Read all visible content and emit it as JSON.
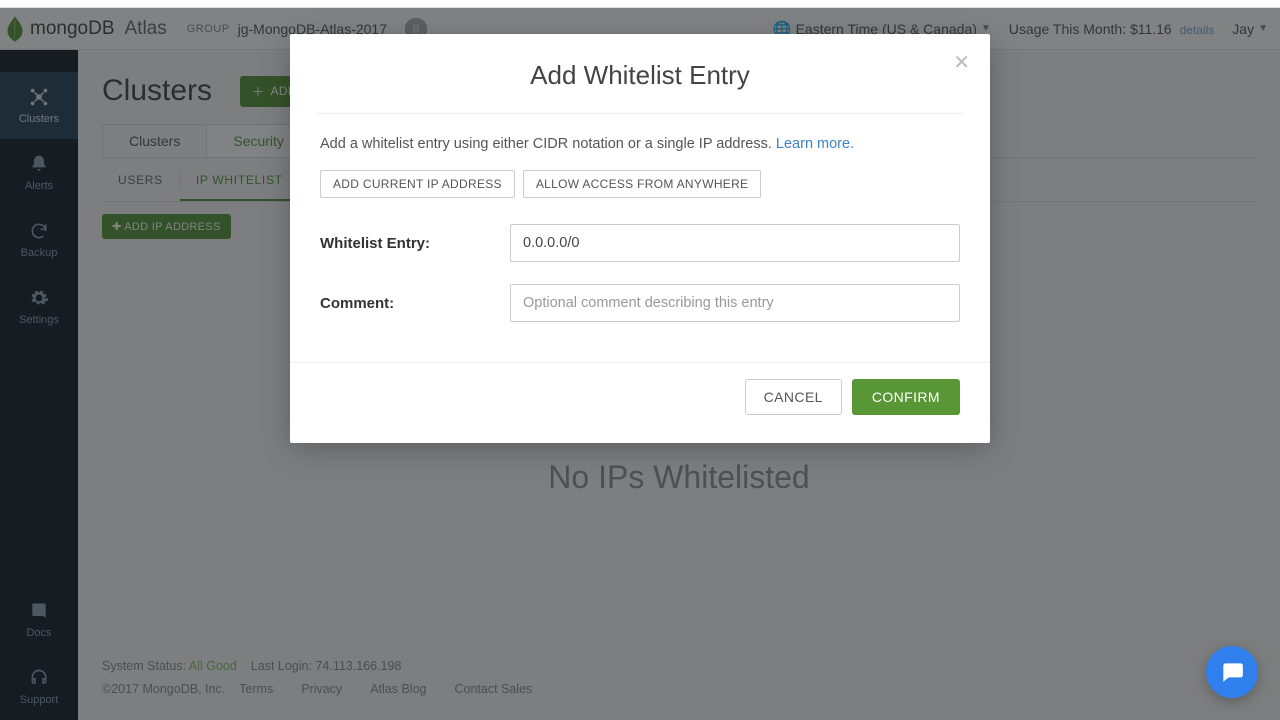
{
  "header": {
    "brand_main": "mongoDB",
    "brand_sub": "Atlas",
    "group_label": "GROUP",
    "group_name": "jg-MongoDB-Atlas-2017",
    "notif_count": "0",
    "timezone": "Eastern Time (US & Canada)",
    "usage_prefix": "Usage This Month: ",
    "usage_amount": "$11.16",
    "usage_details": "details",
    "user_name": "Jay"
  },
  "sidebar": {
    "items": [
      {
        "label": "Clusters",
        "icon": "clusters"
      },
      {
        "label": "Alerts",
        "icon": "bell"
      },
      {
        "label": "Backup",
        "icon": "refresh"
      },
      {
        "label": "Settings",
        "icon": "gear"
      }
    ],
    "bottom": [
      {
        "label": "Docs",
        "icon": "book"
      },
      {
        "label": "Support",
        "icon": "headset"
      }
    ]
  },
  "main": {
    "title": "Clusters",
    "add_label": "ADD NEW CLUSTER",
    "tabs": [
      {
        "label": "Clusters"
      },
      {
        "label": "Security"
      }
    ],
    "subtabs": [
      {
        "label": "USERS"
      },
      {
        "label": "IP WHITELIST"
      }
    ],
    "add_ip_label": "ADD IP ADDRESS",
    "empty_state": "No IPs Whitelisted"
  },
  "footer": {
    "status_label": "System Status: ",
    "status_value": "All Good",
    "last_login_label": "Last Login: ",
    "last_login_value": "74.113.166.198",
    "copyright": "©2017 MongoDB, Inc.",
    "links": [
      "Terms",
      "Privacy",
      "Atlas Blog",
      "Contact Sales"
    ]
  },
  "modal": {
    "title": "Add Whitelist Entry",
    "intro_text": "Add a whitelist entry using either CIDR notation or a single IP address. ",
    "learn_more": "Learn more.",
    "quick_buttons": {
      "current_ip": "ADD CURRENT IP ADDRESS",
      "anywhere": "ALLOW ACCESS FROM ANYWHERE"
    },
    "fields": {
      "entry_label": "Whitelist Entry:",
      "entry_value": "0.0.0.0/0",
      "comment_label": "Comment:",
      "comment_placeholder": "Optional comment describing this entry"
    },
    "buttons": {
      "cancel": "CANCEL",
      "confirm": "CONFIRM"
    }
  }
}
